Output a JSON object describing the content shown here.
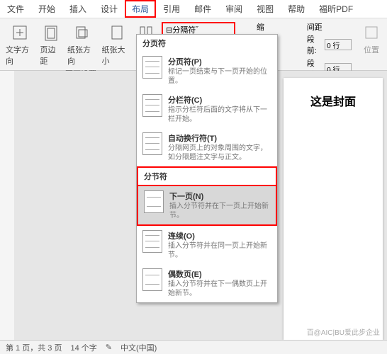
{
  "menu": {
    "items": [
      "文件",
      "开始",
      "插入",
      "设计",
      "布局",
      "引用",
      "邮件",
      "审阅",
      "视图",
      "帮助",
      "福昕PDF"
    ],
    "active_index": 4
  },
  "ribbon": {
    "text_direction": "文字方向",
    "margins": "页边距",
    "orientation": "纸张方向",
    "size": "纸张大小",
    "columns": "栏",
    "page_setup_label": "页面设置",
    "breaks": "分隔符",
    "indent_label": "缩进",
    "spacing_label": "间距",
    "before": "段前:",
    "after": "段后:",
    "before_val": "0 行",
    "after_val": "0 行",
    "position": "位置"
  },
  "dropdown": {
    "page_breaks_header": "分页符",
    "section_breaks_header": "分节符",
    "items": [
      {
        "title": "分页符(P)",
        "desc": "标记一页结束与下一页开始的位置。"
      },
      {
        "title": "分栏符(C)",
        "desc": "指示分栏符后面的文字将从下一栏开始。"
      },
      {
        "title": "自动换行符(T)",
        "desc": "分隔网页上的对象周围的文字，如分隔题注文字与正文。"
      }
    ],
    "section_items": [
      {
        "title": "下一页(N)",
        "desc": "插入分节符并在下一页上开始新节。"
      },
      {
        "title": "连续(O)",
        "desc": "插入分节符并在同一页上开始新节。"
      },
      {
        "title": "偶数页(E)",
        "desc": "插入分节符并在下一偶数页上开始新节。"
      }
    ]
  },
  "document": {
    "title": "这是封面"
  },
  "statusbar": {
    "page": "第 1 页，共 3 页",
    "words": "14 个字",
    "lang": "中文(中国)"
  },
  "watermark": "百@AIC|BU爱此步企业"
}
